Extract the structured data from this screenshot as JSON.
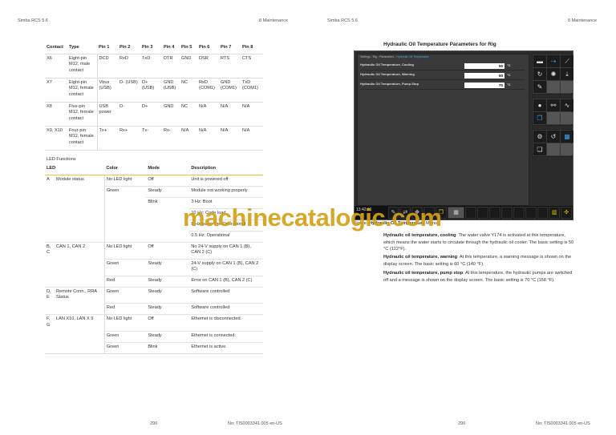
{
  "left_page": {
    "header_left": "Simba RCS 5.6",
    "header_right": "8 Maintenance",
    "contact_table": {
      "headers": [
        "Contact",
        "Type",
        "Pin 1",
        "Pin 2",
        "Pin 3",
        "Pin 4",
        "Pin 5",
        "Pin 6",
        "Pin 7",
        "Pin 8"
      ],
      "rows": [
        [
          "X6",
          "Eight-pin M12, male contact",
          "DCD",
          "RxD",
          "TxD",
          "DTR",
          "GND",
          "DSR",
          "RTS",
          "CTS"
        ],
        [
          "X7",
          "Eight-pin M12, female contact",
          "Vbus (USB)",
          "D- (USB)",
          "D+ (USB)",
          "GND (USB)",
          "NC",
          "RxD (COM1)",
          "GND (COM1)",
          "TxD (COM1)"
        ],
        [
          "X8",
          "Five-pin M12, female contact",
          "USB power",
          "D-",
          "D+",
          "GND",
          "NC",
          "N/A",
          "N/A",
          "N/A"
        ],
        [
          "X9, X10",
          "Four-pin M12, female contact",
          "Tx+",
          "Rx+",
          "Tx-",
          "Rx-",
          "N/A",
          "N/A",
          "N/A",
          "N/A"
        ]
      ]
    },
    "led_title": "LED Functions",
    "led_table": {
      "headers": [
        "LED",
        "Color",
        "Mode",
        "Description"
      ],
      "rows": [
        [
          "A",
          "Module status",
          "No LED light",
          "Off",
          "Unit is powered off"
        ],
        [
          "",
          "",
          "Green",
          "Steady",
          "Module not working properly"
        ],
        [
          "",
          "",
          "",
          "Blink",
          "3 Hz: Boot"
        ],
        [
          "",
          "",
          "",
          "",
          "10 Hz: Code load"
        ],
        [
          "",
          "",
          "",
          "",
          "8 Hz burst: Pre-Operational"
        ],
        [
          "",
          "",
          "",
          "",
          "0.5 Hz: Operational"
        ],
        [
          "B, C",
          "CAN 1, CAN 2",
          "No LED light",
          "Off",
          "No 24-V supply on CAN 1 (B), CAN 2 (C)"
        ],
        [
          "",
          "",
          "Green",
          "Steady",
          "24-V supply on CAN 1 (B), CAN 2 (C)"
        ],
        [
          "",
          "",
          "Red",
          "Steady",
          "Error on CAN 1 (B), CAN 2 (C)"
        ],
        [
          "D, E",
          "Remote Conn., RRA Status",
          "Green",
          "Steady",
          "Software controlled"
        ],
        [
          "",
          "",
          "Red",
          "Steady",
          "Software controlled"
        ],
        [
          "F, G",
          "LAN X10, LAN X 9",
          "No LED light",
          "Off",
          "Ethernet is disconnected."
        ],
        [
          "",
          "",
          "Green",
          "Steady",
          "Ethernet is connected."
        ],
        [
          "",
          "",
          "Green",
          "Blink",
          "Ethernet is active."
        ]
      ]
    },
    "page_number": "290",
    "doc_number": "No: TIS0003341.005 en-US"
  },
  "right_page": {
    "header_left": "Simba RCS 5.6",
    "header_right": "8 Maintenance",
    "title": "Hydraulic Oil Temperature Parameters for Rig",
    "screen": {
      "breadcrumb": "Settings - Rig - Parameters - ",
      "breadcrumb_active": "Hydraulic Oil Temperature",
      "params": [
        {
          "label": "Hydraulic Oil Temperature, Cooling",
          "value": "50",
          "unit": "°C"
        },
        {
          "label": "Hydraulic Oil Temperature, Warning",
          "value": "60",
          "unit": "°C"
        },
        {
          "label": "Hydraulic Oil Temperature, Pump Stop",
          "value": "70",
          "unit": "°C"
        }
      ],
      "time": "13:42:16",
      "status": "Stora"
    },
    "caption_prefix": "Figure: ",
    "caption_bold": "Hydraulic Oil Temperature",
    "caption_suffix": " Menu",
    "paragraphs": [
      {
        "bold": "Hydraulic oil temperature, cooling",
        "text": ": The water valve Y174 is activated at this temperature, which means the water starts to circulate through the hydraulic oil cooler. The basic setting is 50 °C (122°F)."
      },
      {
        "bold": "Hydraulic oil temperature, warning",
        "text": ": At this temperature, a warning message is shown on the display screen. The basic setting is 60 °C (140 °F)."
      },
      {
        "bold": "Hydraulic oil temperature, pump stop",
        "text": ": At this temperature, the hydraulic pumps are switched off and a message is shown on the display screen. The basic setting is 70 °C (158 °F)."
      }
    ],
    "page_number": "290",
    "doc_number": "No: TIS0003341.005 en-US"
  },
  "watermark": "machinecatalogic.com"
}
